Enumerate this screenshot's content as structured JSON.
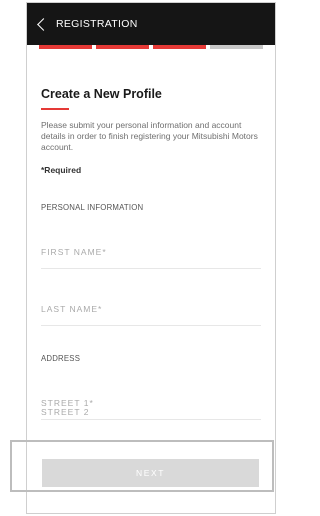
{
  "header": {
    "title": "REGISTRATION"
  },
  "progress": {
    "steps": [
      {
        "state": "active"
      },
      {
        "state": "active"
      },
      {
        "state": "active"
      },
      {
        "state": "inactive"
      }
    ]
  },
  "main": {
    "heading": "Create a New Profile",
    "description": "Please submit your personal information and account details in order to finish registering your Mitsubishi Motors account.",
    "required_note": "*Required",
    "sections": {
      "personal_info": "PERSONAL INFORMATION",
      "address": "ADDRESS"
    },
    "fields": {
      "first_name": {
        "placeholder": "FIRST NAME*",
        "value": ""
      },
      "last_name": {
        "placeholder": "LAST NAME*",
        "value": ""
      },
      "street_1": {
        "placeholder": "STREET 1*",
        "value": ""
      },
      "street_2": {
        "placeholder": "STREET 2",
        "value": ""
      }
    }
  },
  "footer": {
    "next_label": "NEXT"
  },
  "colors": {
    "accent": "#e53936",
    "topbar": "#151515",
    "button_bg": "#d9d9d9"
  },
  "icons": {
    "back": "chevron-left-icon"
  }
}
